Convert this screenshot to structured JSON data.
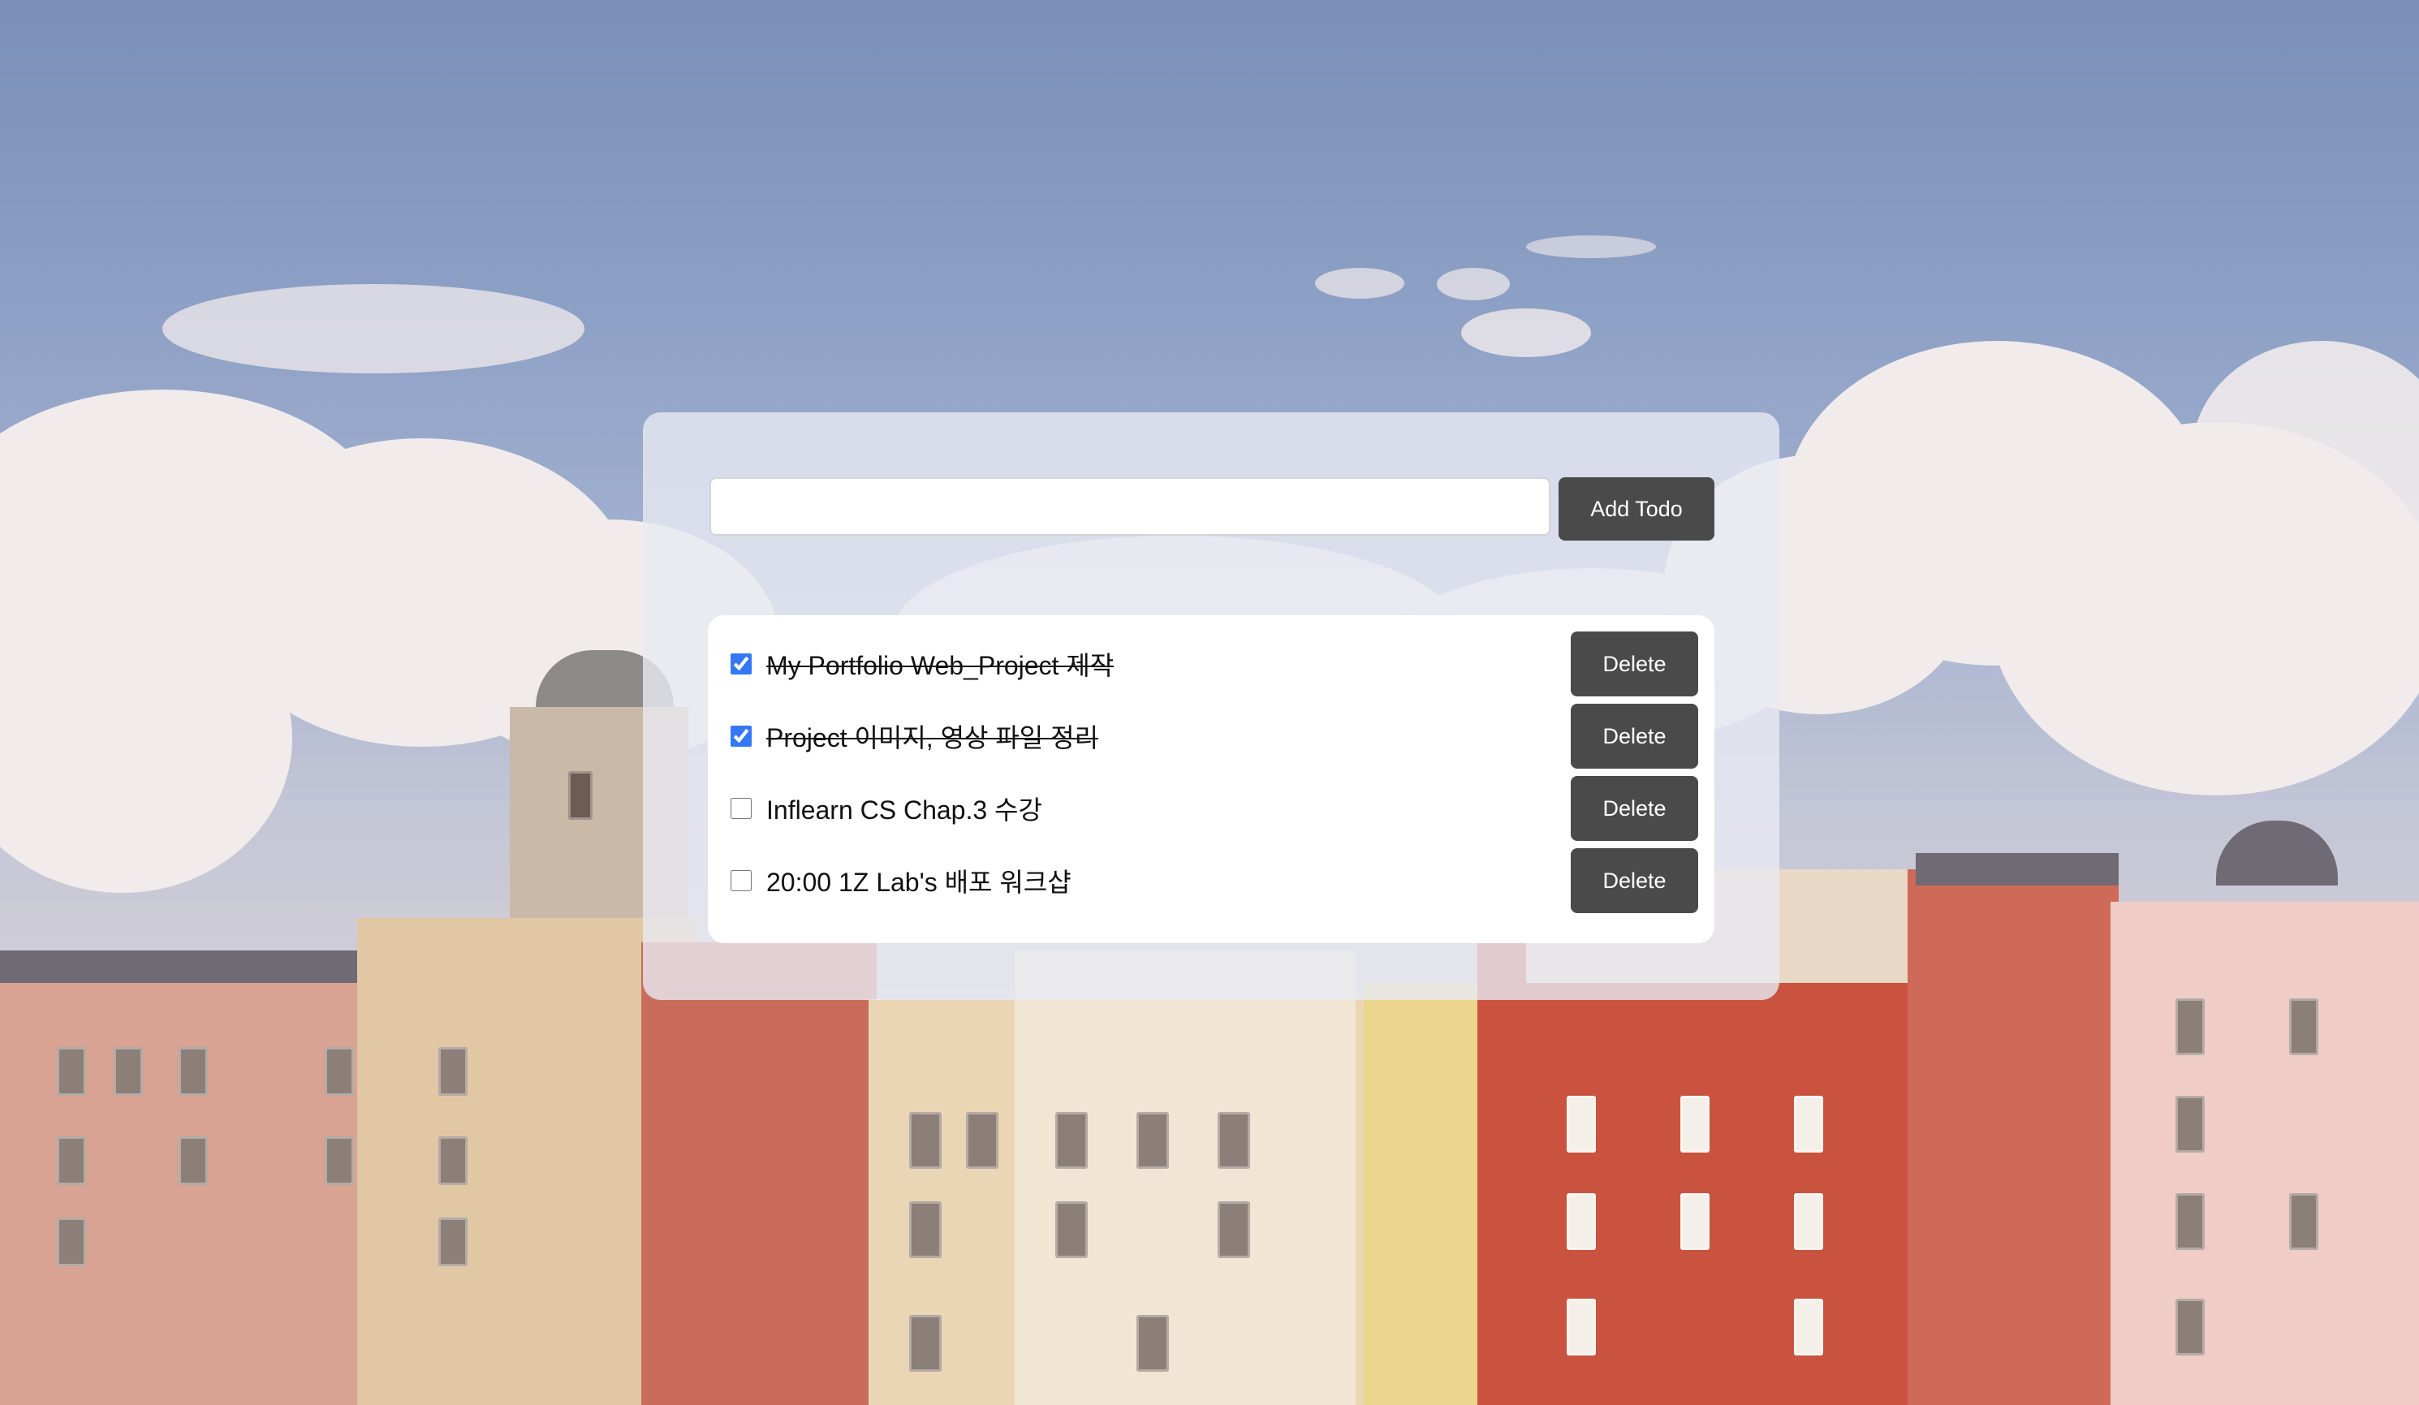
{
  "form": {
    "input_value": "",
    "input_placeholder": "",
    "add_label": "Add Todo"
  },
  "todos": [
    {
      "text": "My Portfolio Web_Project 제작",
      "done": true,
      "delete_label": "Delete"
    },
    {
      "text": "Project 이미지, 영상 파일 정리",
      "done": true,
      "delete_label": "Delete"
    },
    {
      "text": "Inflearn CS Chap.3 수강",
      "done": false,
      "delete_label": "Delete"
    },
    {
      "text": "20:00 1Z Lab's 배포 워크샵",
      "done": false,
      "delete_label": "Delete"
    }
  ],
  "colors": {
    "button_bg": "#4a4a4a",
    "checkbox_accent": "#3478f6",
    "card_bg": "rgba(232,234,242,0.80)"
  }
}
